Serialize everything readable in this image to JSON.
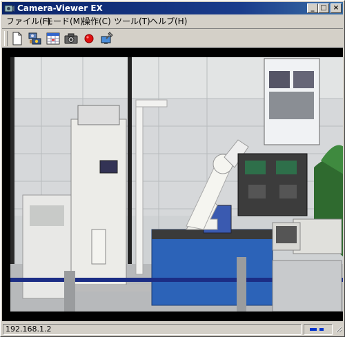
{
  "window": {
    "title": "Camera-Viewer EX",
    "controls": {
      "minimize": "_",
      "maximize": "□",
      "close": "×"
    }
  },
  "menu": {
    "items": [
      {
        "label": "ファイル(F)"
      },
      {
        "label": "モード(M)"
      },
      {
        "label": "操作(C)"
      },
      {
        "label": "ツール(T)"
      },
      {
        "label": "ヘルプ(H)"
      }
    ]
  },
  "toolbar": {
    "buttons": [
      {
        "icon": "new-document-icon"
      },
      {
        "icon": "camera-settings-icon"
      },
      {
        "icon": "schedule-grid-icon"
      },
      {
        "icon": "snapshot-camera-icon"
      },
      {
        "icon": "record-icon",
        "color": "#e01010"
      },
      {
        "icon": "tools-monitor-icon"
      }
    ]
  },
  "status": {
    "address": "192.168.1.2",
    "signal_color": "#0033cc"
  }
}
